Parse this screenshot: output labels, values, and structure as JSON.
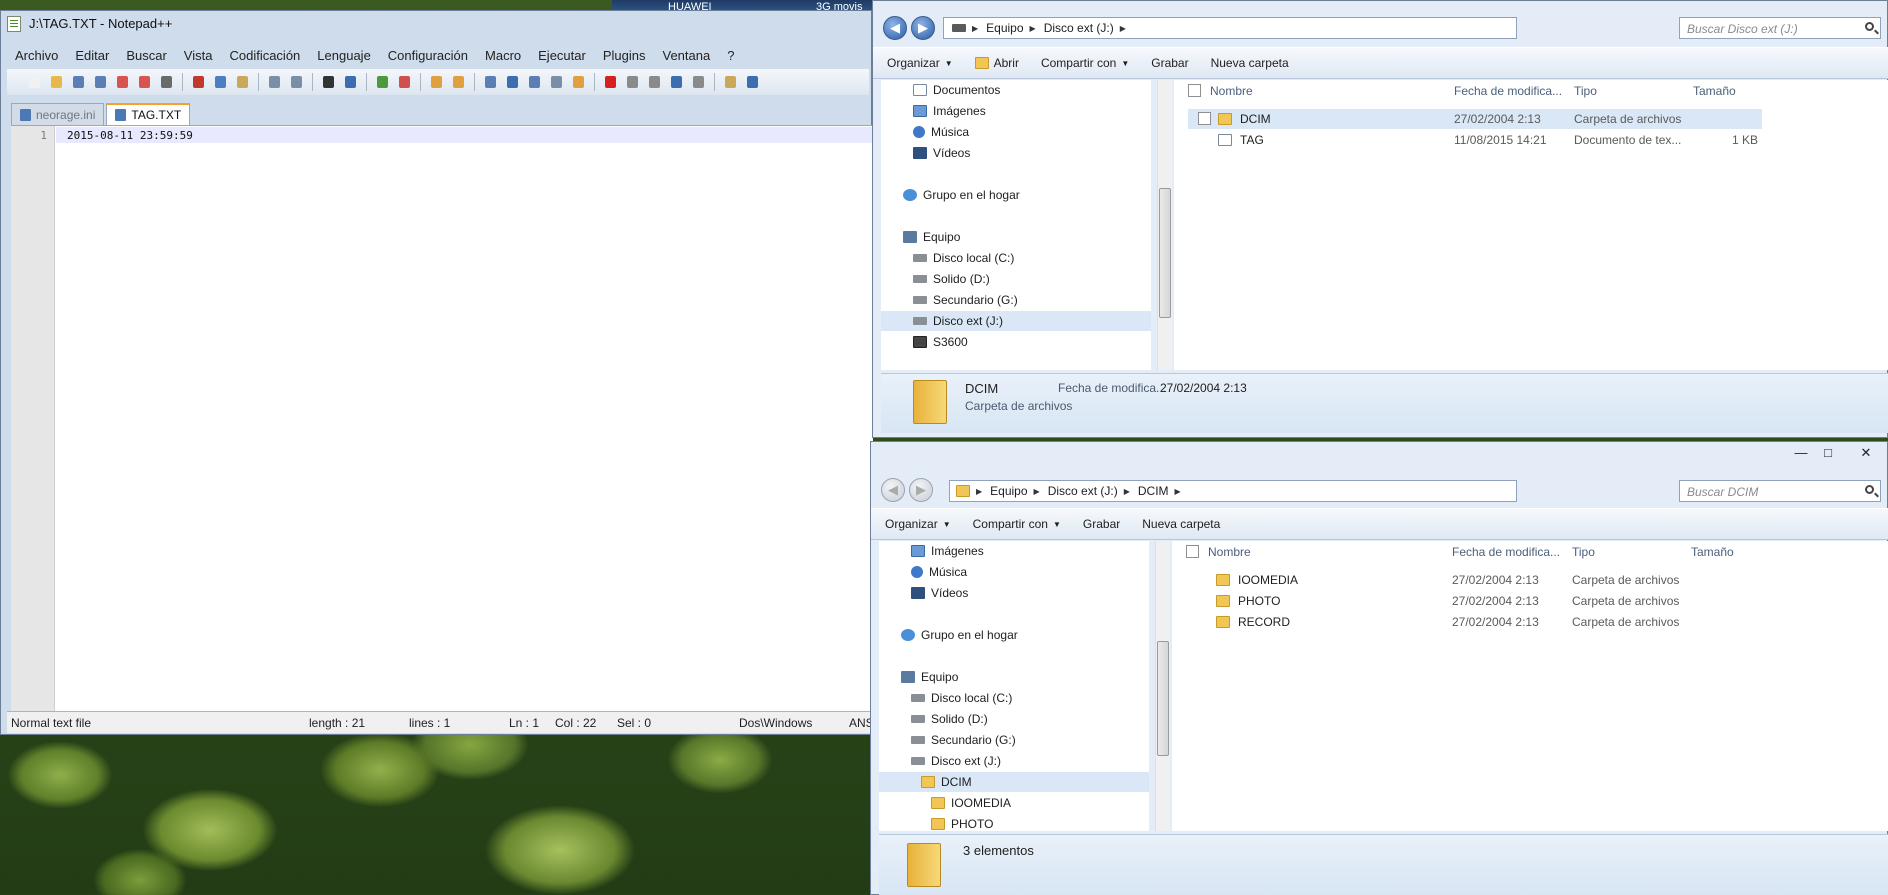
{
  "bg_widget": {
    "carrier": "HUAWEI",
    "network": "3G movis"
  },
  "notepad": {
    "title": "J:\\TAG.TXT - Notepad++",
    "menu": [
      "Archivo",
      "Editar",
      "Buscar",
      "Vista",
      "Codificación",
      "Lenguaje",
      "Configuración",
      "Macro",
      "Ejecutar",
      "Plugins",
      "Ventana",
      "?"
    ],
    "tabs": [
      {
        "label": "neorage.ini",
        "active": false
      },
      {
        "label": "TAG.TXT",
        "active": true
      }
    ],
    "line_number": "1",
    "line_text": "2015-08-11 23:59:59",
    "status": {
      "type": "Normal text file",
      "length": "length : 21",
      "lines": "lines : 1",
      "ln": "Ln : 1",
      "col": "Col : 22",
      "sel": "Sel : 0",
      "eol": "Dos\\Windows",
      "enc": "ANS"
    }
  },
  "explorer1": {
    "breadcrumb": [
      "Equipo",
      "Disco ext (J:)"
    ],
    "search_placeholder": "Buscar Disco ext (J:)",
    "commands": [
      "Organizar",
      "Abrir",
      "Compartir con",
      "Grabar",
      "Nueva carpeta"
    ],
    "tree": [
      {
        "label": "Documentos",
        "icon": "doc"
      },
      {
        "label": "Imágenes",
        "icon": "img"
      },
      {
        "label": "Música",
        "icon": "mus"
      },
      {
        "label": "Vídeos",
        "icon": "vid"
      },
      {
        "label": "Grupo en el hogar",
        "icon": "home"
      },
      {
        "label": "Equipo",
        "icon": "pc"
      },
      {
        "label": "Disco local (C:)",
        "icon": "hdd"
      },
      {
        "label": "Solido (D:)",
        "icon": "hdd"
      },
      {
        "label": "Secundario (G:)",
        "icon": "hdd"
      },
      {
        "label": "Disco ext (J:)",
        "icon": "hdd"
      },
      {
        "label": "S3600",
        "icon": "cam"
      }
    ],
    "columns": [
      "Nombre",
      "Fecha de modifica...",
      "Tipo",
      "Tamaño"
    ],
    "files": [
      {
        "name": "DCIM",
        "date": "27/02/2004 2:13",
        "type": "Carpeta de archivos",
        "size": ""
      },
      {
        "name": "TAG",
        "date": "11/08/2015 14:21",
        "type": "Documento de tex...",
        "size": "1 KB"
      }
    ],
    "details": {
      "name": "DCIM",
      "date_label": "Fecha de modifica...",
      "date": "27/02/2004 2:13",
      "type": "Carpeta de archivos"
    }
  },
  "explorer2": {
    "breadcrumb": [
      "Equipo",
      "Disco ext (J:)",
      "DCIM"
    ],
    "search_placeholder": "Buscar DCIM",
    "commands": [
      "Organizar",
      "Compartir con",
      "Grabar",
      "Nueva carpeta"
    ],
    "tree": [
      {
        "label": "Imágenes",
        "icon": "img"
      },
      {
        "label": "Música",
        "icon": "mus"
      },
      {
        "label": "Vídeos",
        "icon": "vid"
      },
      {
        "label": "Grupo en el hogar",
        "icon": "home"
      },
      {
        "label": "Equipo",
        "icon": "pc"
      },
      {
        "label": "Disco local (C:)",
        "icon": "hdd"
      },
      {
        "label": "Solido (D:)",
        "icon": "hdd"
      },
      {
        "label": "Secundario (G:)",
        "icon": "hdd"
      },
      {
        "label": "Disco ext (J:)",
        "icon": "hdd"
      },
      {
        "label": "DCIM",
        "icon": "fold"
      },
      {
        "label": "IOOMEDIA",
        "icon": "fold"
      },
      {
        "label": "PHOTO",
        "icon": "fold"
      }
    ],
    "columns": [
      "Nombre",
      "Fecha de modifica...",
      "Tipo",
      "Tamaño"
    ],
    "files": [
      {
        "name": "IOOMEDIA",
        "date": "27/02/2004 2:13",
        "type": "Carpeta de archivos"
      },
      {
        "name": "PHOTO",
        "date": "27/02/2004 2:13",
        "type": "Carpeta de archivos"
      },
      {
        "name": "RECORD",
        "date": "27/02/2004 2:13",
        "type": "Carpeta de archivos"
      }
    ],
    "status": "3 elementos"
  }
}
